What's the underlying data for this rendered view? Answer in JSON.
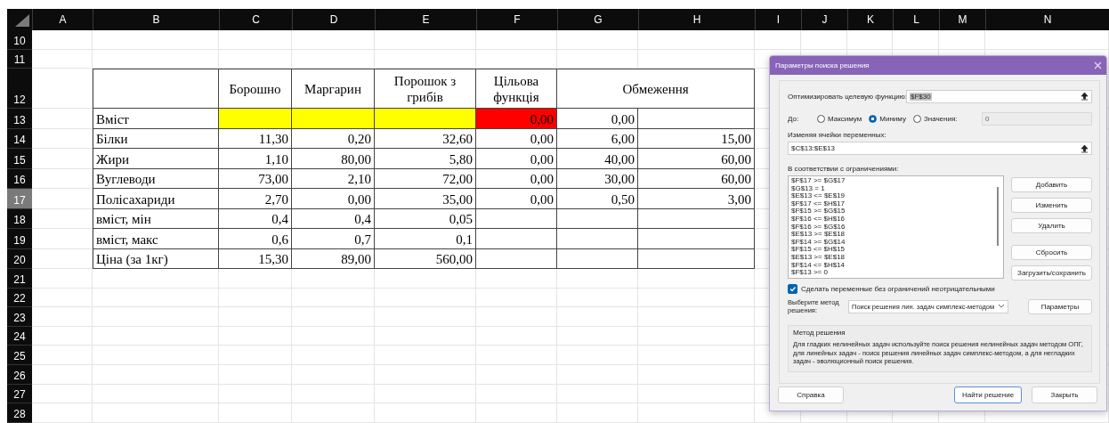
{
  "sheet": {
    "columns": [
      "A",
      "B",
      "C",
      "D",
      "E",
      "F",
      "G",
      "H",
      "I",
      "J",
      "K",
      "L",
      "M",
      "N"
    ],
    "row_numbers": [
      {
        "label": "10",
        "selected": false
      },
      {
        "label": "11",
        "selected": false
      },
      {
        "label": "12",
        "selected": false
      },
      {
        "label": "13",
        "selected": false
      },
      {
        "label": "14",
        "selected": false
      },
      {
        "label": "15",
        "selected": false
      },
      {
        "label": "16",
        "selected": false
      },
      {
        "label": "17",
        "selected": true
      },
      {
        "label": "18",
        "selected": false
      },
      {
        "label": "19",
        "selected": false
      },
      {
        "label": "20",
        "selected": false
      },
      {
        "label": "21",
        "selected": false
      },
      {
        "label": "22",
        "selected": false
      },
      {
        "label": "23",
        "selected": false
      },
      {
        "label": "24",
        "selected": false
      },
      {
        "label": "25",
        "selected": false
      },
      {
        "label": "26",
        "selected": false
      },
      {
        "label": "27",
        "selected": false
      },
      {
        "label": "28",
        "selected": false
      }
    ],
    "table": {
      "header": [
        "Борошно",
        "Маргарин",
        "Порошок з грибів",
        "Цільова функція",
        "Обмеження"
      ],
      "rows": [
        {
          "label": "Вміст",
          "cells": [
            {
              "color": "#ffff00"
            },
            {
              "color": "#ffff00"
            },
            {
              "color": "#ffff00"
            },
            {
              "value": "0,00",
              "color": "#ff0000"
            },
            {
              "value": "0,00"
            }
          ]
        },
        {
          "label": "Білки",
          "cells": [
            {
              "value": "11,30"
            },
            {
              "value": "0,20"
            },
            {
              "value": "32,60"
            },
            {
              "value": "0,00"
            },
            {
              "value": "6,00"
            },
            {
              "value": "15,00"
            }
          ]
        },
        {
          "label": "Жири",
          "cells": [
            {
              "value": "1,10"
            },
            {
              "value": "80,00"
            },
            {
              "value": "5,80"
            },
            {
              "value": "0,00"
            },
            {
              "value": "40,00"
            },
            {
              "value": "60,00"
            }
          ]
        },
        {
          "label": "Вуглеводи",
          "cells": [
            {
              "value": "73,00"
            },
            {
              "value": "2,10"
            },
            {
              "value": "72,00"
            },
            {
              "value": "0,00"
            },
            {
              "value": "30,00"
            },
            {
              "value": "60,00"
            }
          ]
        },
        {
          "label": "Полісахариди",
          "cells": [
            {
              "value": "2,70"
            },
            {
              "value": "0,00"
            },
            {
              "value": "35,00"
            },
            {
              "value": "0,00"
            },
            {
              "value": "0,50"
            },
            {
              "value": "3,00"
            }
          ]
        },
        {
          "label": "вміст, мін",
          "cells": [
            {
              "value": "0,4"
            },
            {
              "value": "0,4"
            },
            {
              "value": "0,05"
            }
          ]
        },
        {
          "label": "вміст, макс",
          "cells": [
            {
              "value": "0,6"
            },
            {
              "value": "0,7"
            },
            {
              "value": "0,1"
            }
          ]
        },
        {
          "label": "Ціна (за 1кг)",
          "cells": [
            {
              "value": "15,30"
            },
            {
              "value": "89,00"
            },
            {
              "value": "560,00"
            }
          ]
        }
      ]
    }
  },
  "dialog": {
    "title": "Параметры поиска решения",
    "objective_label": "Оптимизировать целевую функцию:",
    "objective_value": "$F$30",
    "to_label": "До:",
    "options": [
      {
        "label": "Максимум",
        "selected": false
      },
      {
        "label": "Миниму",
        "selected": true
      },
      {
        "label": "Значения:",
        "selected": false
      }
    ],
    "value_field": {
      "value": "0",
      "disabled": true
    },
    "variables_label": "Изменяя ячейки переменных:",
    "variables_value": "$C$13:$E$13",
    "constraints_label": "В соответствии с ограничениями:",
    "constraints": [
      "$F$17 >= $G$17",
      "$G$13 = 1",
      "$E$13 <= $E$19",
      "$F$17 <= $H$17",
      "$F$15 >= $G$15",
      "$F$16 <= $H$16",
      "$F$16 >= $G$16",
      "$E$13 >= $E$18",
      "$F$14 >= $G$14",
      "$F$15 <= $H$15",
      "$E$13 >= $E$18",
      "$F$14 <= $H$14",
      "$F$13 >= 0"
    ],
    "side_buttons": [
      "Добавить",
      "Изменить",
      "Удалить",
      "Сбросить",
      "Загрузить/сохранить"
    ],
    "nonnegative": {
      "label": "Сделать переменные без ограничений неотрицательными",
      "checked": true
    },
    "method_label": "Выберите метод решения:",
    "method_value": "Поиск решения лин. задач симплекс-методом",
    "parameters_button": "Параметры",
    "method_box": {
      "title": "Метод решения",
      "text": "Для гладких нелинейных задач используйте поиск решения нелинейных задач методом ОПГ, для линейных задач - поиск решения линейных задач симплекс-методом, а для негладких задач - эволюционный поиск решения."
    },
    "buttons": [
      "Справка",
      "Найти решение",
      "Закрыть"
    ]
  }
}
